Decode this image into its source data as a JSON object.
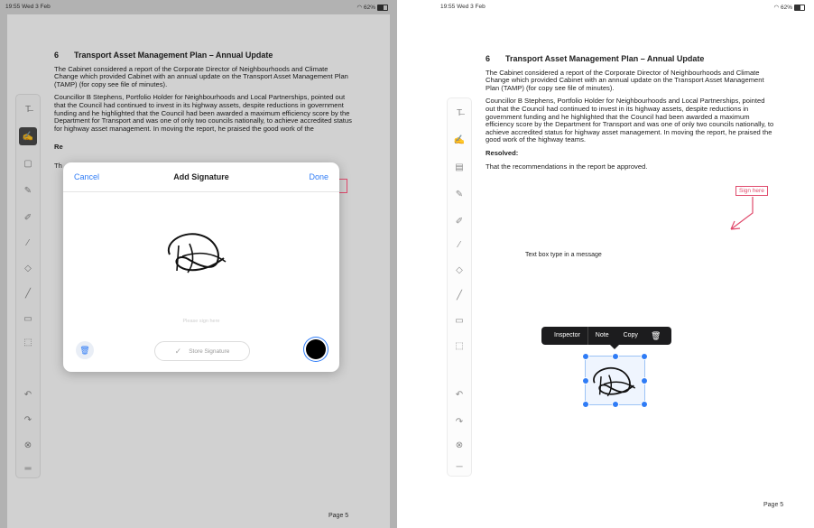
{
  "left": {
    "status": {
      "time": "19:55  Wed 3 Feb",
      "battery": "62%"
    },
    "document": {
      "item_number": "6",
      "heading": "Transport Asset Management Plan – Annual Update",
      "para1": "The Cabinet considered a report of the Corporate Director of Neighbourhoods and Climate Change which provided Cabinet with an annual update on the Transport Asset Management Plan (TAMP) (for copy see file of minutes).",
      "para2": "Councillor B Stephens, Portfolio Holder for Neighbourhoods and Local Partnerships, pointed out that the Council had continued to invest in its highway assets, despite reductions in government funding and he highlighted that the Council had been awarded a maximum efficiency score by the Department for Transport and was one of only two councils nationally, to achieve accredited status for highway asset management.  In moving the report, he praised the good work of the",
      "resolved_fragment": "Re",
      "that_fragment": "Th",
      "page": "Page 5"
    },
    "dialog": {
      "cancel": "Cancel",
      "title": "Add Signature",
      "done": "Done",
      "hint": "Please sign here",
      "store": "Store Signature"
    }
  },
  "right": {
    "status": {
      "time": "19:55  Wed 3 Feb",
      "battery": "62%"
    },
    "document": {
      "item_number": "6",
      "heading": "Transport Asset Management Plan – Annual Update",
      "para1": "The Cabinet considered a report of the Corporate Director of Neighbourhoods and Climate Change which provided Cabinet with an annual update on the Transport Asset Management Plan (TAMP) (for copy see file of minutes).",
      "para2": "Councillor B Stephens, Portfolio Holder for Neighbourhoods and Local Partnerships, pointed out that the Council had continued to invest in its highway assets, despite reductions in government funding and he highlighted that the Council had been awarded a maximum efficiency score by the Department for Transport and was one of only two councils nationally, to achieve accredited status for highway asset management.  In moving the report, he praised the good work of the highway teams.",
      "resolved": "Resolved:",
      "resolution": "That the recommendations in the report be approved.",
      "page": "Page 5"
    },
    "sign_here": "Sign here",
    "text_box": "Text box type in a message",
    "context_menu": {
      "inspector": "Inspector",
      "note": "Note",
      "copy": "Copy"
    }
  },
  "colors": {
    "accent": "#2f7cf6",
    "sign_here": "#e04a6c",
    "menu_bg": "#1c1c1e"
  },
  "icons": [
    "text-tool-icon",
    "signature-tool-icon",
    "note-tool-icon",
    "pen-tool-icon",
    "stamp-tool-icon",
    "highlighter-icon",
    "eraser-icon",
    "line-tool-icon",
    "image-tool-icon",
    "selection-tool-icon",
    "undo-icon",
    "redo-icon",
    "clear-icon",
    "menu-icon",
    "trash-icon",
    "checkmark-icon"
  ]
}
